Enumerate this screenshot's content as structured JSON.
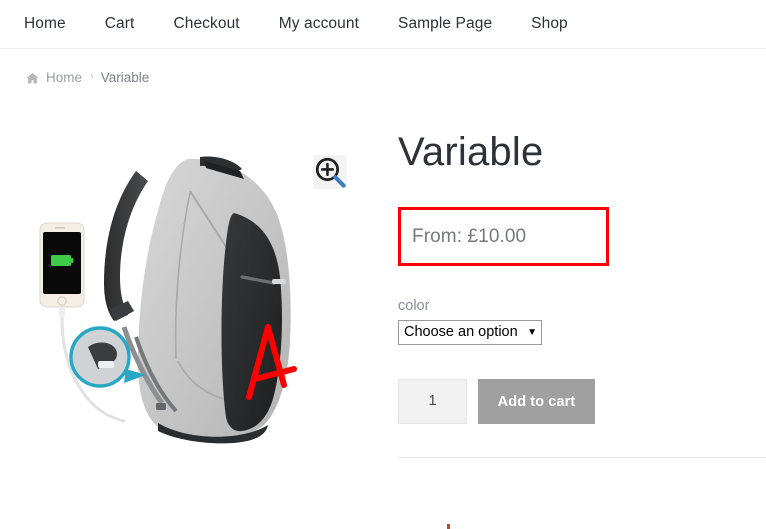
{
  "nav": {
    "items": [
      {
        "label": "Home",
        "name": "nav-item-home"
      },
      {
        "label": "Cart",
        "name": "nav-item-cart"
      },
      {
        "label": "Checkout",
        "name": "nav-item-checkout"
      },
      {
        "label": "My account",
        "name": "nav-item-my-account"
      },
      {
        "label": "Sample Page",
        "name": "nav-item-sample-page"
      },
      {
        "label": "Shop",
        "name": "nav-item-shop"
      }
    ]
  },
  "breadcrumb": {
    "home_icon": "home-icon",
    "home_label": "Home",
    "separator": "›",
    "current": "Variable"
  },
  "gallery": {
    "zoom_icon": "magnifier-plus-icon",
    "image_alt": "grey and black anti-theft backpack with USB charging phone"
  },
  "product": {
    "title": "Variable",
    "price": "From: £10.00",
    "price_highlight_color": "#fa0000",
    "attribute": {
      "label": "color",
      "selected": "Choose an option",
      "caret": "▼"
    },
    "quantity": "1",
    "add_to_cart_label": "Add to cart",
    "add_to_cart_color": "#a0a0a0"
  }
}
